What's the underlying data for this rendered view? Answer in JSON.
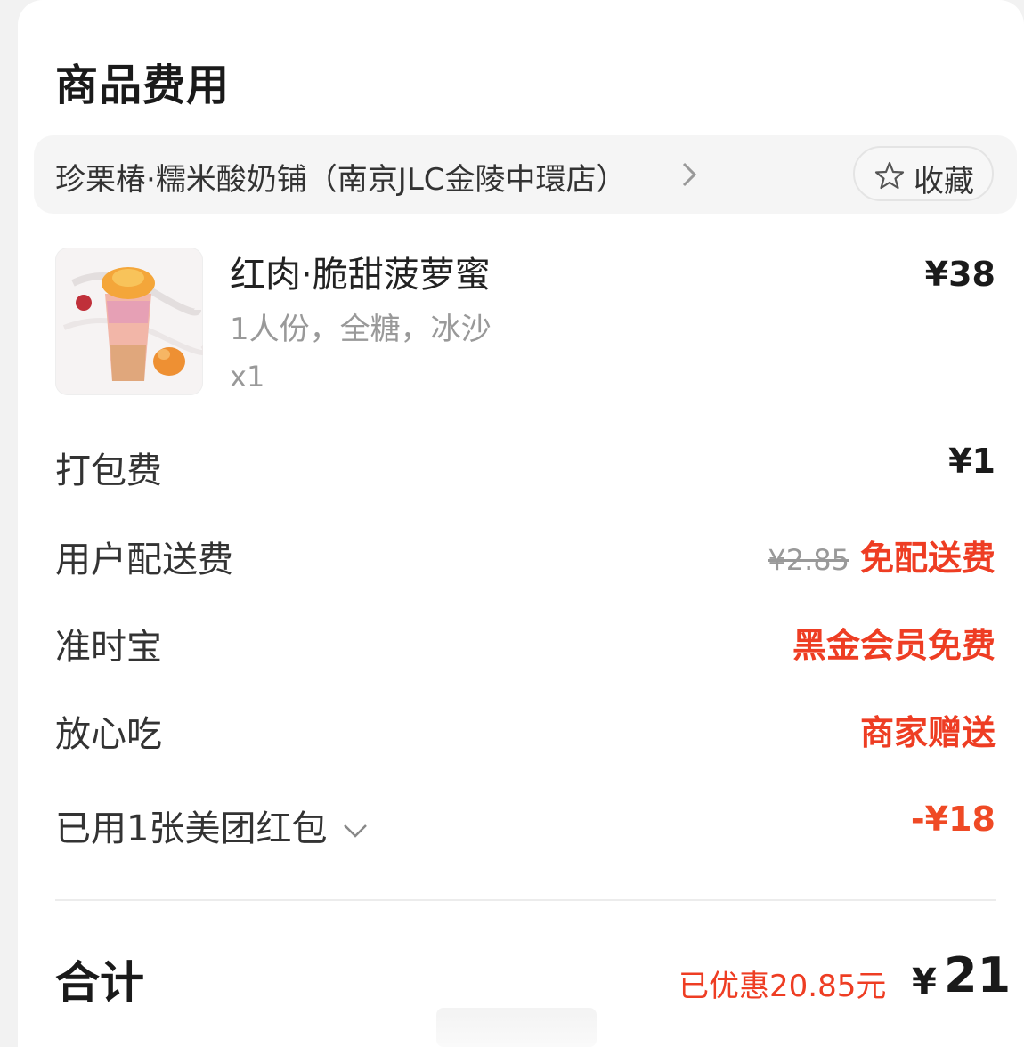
{
  "section": {
    "title": "商品费用"
  },
  "store": {
    "name": "珍栗椿·糯米酸奶铺（南京JLC金陵中環店）",
    "favorite_label": "收藏"
  },
  "product": {
    "name": "红肉·脆甜菠萝蜜",
    "spec": "1人份，全糖，冰沙",
    "qty": "x1",
    "price": "¥38"
  },
  "fees": {
    "packing": {
      "label": "打包费",
      "value": "¥1"
    },
    "delivery": {
      "label": "用户配送费",
      "original": "¥2.85",
      "value": "免配送费"
    },
    "ontime": {
      "label": "准时宝",
      "value": "黑金会员免费"
    },
    "safe": {
      "label": "放心吃",
      "value": "商家赠送"
    },
    "coupon": {
      "label": "已用1张美团红包",
      "value": "-¥18"
    }
  },
  "total": {
    "label": "合计",
    "saved": "已优惠20.85元",
    "currency": "¥",
    "amount": "21"
  },
  "colors": {
    "accent_red": "#ee3d23",
    "text_dark": "#1a1a1a",
    "text_muted": "#999999"
  }
}
